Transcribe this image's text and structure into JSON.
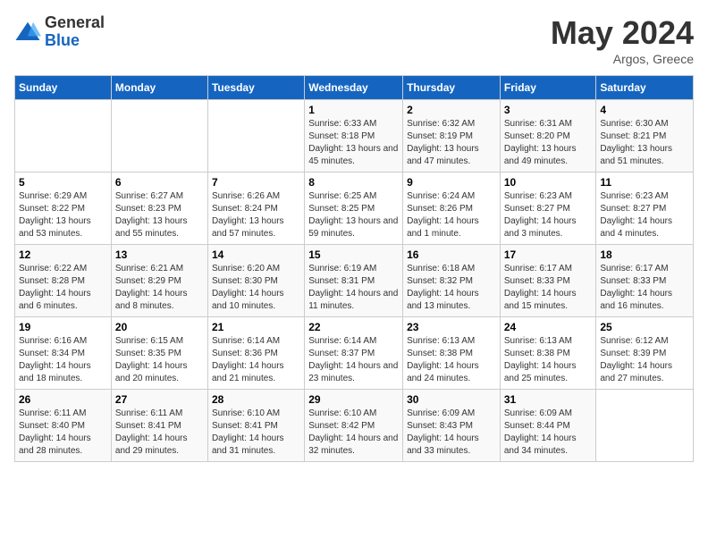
{
  "header": {
    "logo_general": "General",
    "logo_blue": "Blue",
    "month_year": "May 2024",
    "location": "Argos, Greece"
  },
  "days_of_week": [
    "Sunday",
    "Monday",
    "Tuesday",
    "Wednesday",
    "Thursday",
    "Friday",
    "Saturday"
  ],
  "weeks": [
    [
      {
        "day": "",
        "info": ""
      },
      {
        "day": "",
        "info": ""
      },
      {
        "day": "",
        "info": ""
      },
      {
        "day": "1",
        "info": "Sunrise: 6:33 AM\nSunset: 8:18 PM\nDaylight: 13 hours and 45 minutes."
      },
      {
        "day": "2",
        "info": "Sunrise: 6:32 AM\nSunset: 8:19 PM\nDaylight: 13 hours and 47 minutes."
      },
      {
        "day": "3",
        "info": "Sunrise: 6:31 AM\nSunset: 8:20 PM\nDaylight: 13 hours and 49 minutes."
      },
      {
        "day": "4",
        "info": "Sunrise: 6:30 AM\nSunset: 8:21 PM\nDaylight: 13 hours and 51 minutes."
      }
    ],
    [
      {
        "day": "5",
        "info": "Sunrise: 6:29 AM\nSunset: 8:22 PM\nDaylight: 13 hours and 53 minutes."
      },
      {
        "day": "6",
        "info": "Sunrise: 6:27 AM\nSunset: 8:23 PM\nDaylight: 13 hours and 55 minutes."
      },
      {
        "day": "7",
        "info": "Sunrise: 6:26 AM\nSunset: 8:24 PM\nDaylight: 13 hours and 57 minutes."
      },
      {
        "day": "8",
        "info": "Sunrise: 6:25 AM\nSunset: 8:25 PM\nDaylight: 13 hours and 59 minutes."
      },
      {
        "day": "9",
        "info": "Sunrise: 6:24 AM\nSunset: 8:26 PM\nDaylight: 14 hours and 1 minute."
      },
      {
        "day": "10",
        "info": "Sunrise: 6:23 AM\nSunset: 8:27 PM\nDaylight: 14 hours and 3 minutes."
      },
      {
        "day": "11",
        "info": "Sunrise: 6:23 AM\nSunset: 8:27 PM\nDaylight: 14 hours and 4 minutes."
      }
    ],
    [
      {
        "day": "12",
        "info": "Sunrise: 6:22 AM\nSunset: 8:28 PM\nDaylight: 14 hours and 6 minutes."
      },
      {
        "day": "13",
        "info": "Sunrise: 6:21 AM\nSunset: 8:29 PM\nDaylight: 14 hours and 8 minutes."
      },
      {
        "day": "14",
        "info": "Sunrise: 6:20 AM\nSunset: 8:30 PM\nDaylight: 14 hours and 10 minutes."
      },
      {
        "day": "15",
        "info": "Sunrise: 6:19 AM\nSunset: 8:31 PM\nDaylight: 14 hours and 11 minutes."
      },
      {
        "day": "16",
        "info": "Sunrise: 6:18 AM\nSunset: 8:32 PM\nDaylight: 14 hours and 13 minutes."
      },
      {
        "day": "17",
        "info": "Sunrise: 6:17 AM\nSunset: 8:33 PM\nDaylight: 14 hours and 15 minutes."
      },
      {
        "day": "18",
        "info": "Sunrise: 6:17 AM\nSunset: 8:33 PM\nDaylight: 14 hours and 16 minutes."
      }
    ],
    [
      {
        "day": "19",
        "info": "Sunrise: 6:16 AM\nSunset: 8:34 PM\nDaylight: 14 hours and 18 minutes."
      },
      {
        "day": "20",
        "info": "Sunrise: 6:15 AM\nSunset: 8:35 PM\nDaylight: 14 hours and 20 minutes."
      },
      {
        "day": "21",
        "info": "Sunrise: 6:14 AM\nSunset: 8:36 PM\nDaylight: 14 hours and 21 minutes."
      },
      {
        "day": "22",
        "info": "Sunrise: 6:14 AM\nSunset: 8:37 PM\nDaylight: 14 hours and 23 minutes."
      },
      {
        "day": "23",
        "info": "Sunrise: 6:13 AM\nSunset: 8:38 PM\nDaylight: 14 hours and 24 minutes."
      },
      {
        "day": "24",
        "info": "Sunrise: 6:13 AM\nSunset: 8:38 PM\nDaylight: 14 hours and 25 minutes."
      },
      {
        "day": "25",
        "info": "Sunrise: 6:12 AM\nSunset: 8:39 PM\nDaylight: 14 hours and 27 minutes."
      }
    ],
    [
      {
        "day": "26",
        "info": "Sunrise: 6:11 AM\nSunset: 8:40 PM\nDaylight: 14 hours and 28 minutes."
      },
      {
        "day": "27",
        "info": "Sunrise: 6:11 AM\nSunset: 8:41 PM\nDaylight: 14 hours and 29 minutes."
      },
      {
        "day": "28",
        "info": "Sunrise: 6:10 AM\nSunset: 8:41 PM\nDaylight: 14 hours and 31 minutes."
      },
      {
        "day": "29",
        "info": "Sunrise: 6:10 AM\nSunset: 8:42 PM\nDaylight: 14 hours and 32 minutes."
      },
      {
        "day": "30",
        "info": "Sunrise: 6:09 AM\nSunset: 8:43 PM\nDaylight: 14 hours and 33 minutes."
      },
      {
        "day": "31",
        "info": "Sunrise: 6:09 AM\nSunset: 8:44 PM\nDaylight: 14 hours and 34 minutes."
      },
      {
        "day": "",
        "info": ""
      }
    ]
  ]
}
